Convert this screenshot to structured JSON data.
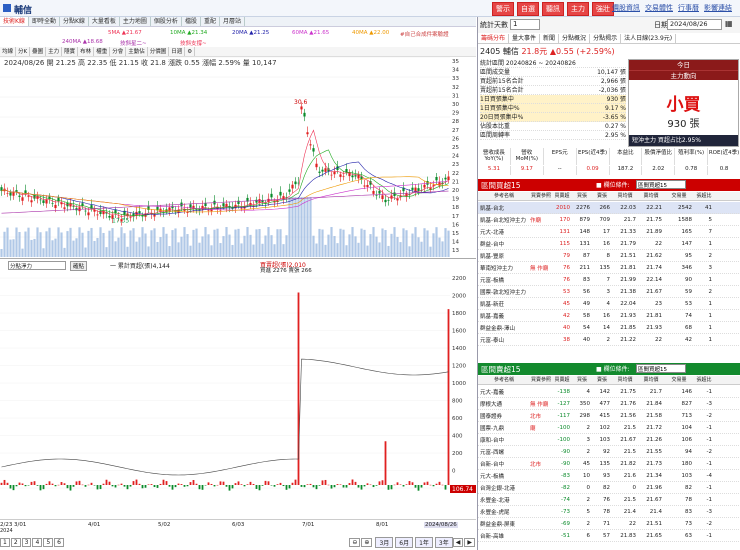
{
  "stock": {
    "name": "輔信"
  },
  "top_buttons": [
    "警示",
    "自選",
    "聽訊",
    "主力",
    "強壯"
  ],
  "top_links": [
    "價股資訊",
    "交易體性",
    "行事曆",
    "影響連結"
  ],
  "left_tabs": [
    "技術K線",
    "即時全動",
    "分點K線",
    "大量看板",
    "主力地圖",
    "個股分析",
    "檔股",
    "重配",
    "月層站"
  ],
  "ma_legend": {
    "ma5": "5MA ▲21.67",
    "ma10": "10MA ▲21.34",
    "ma20": "20MA ▲21.25",
    "ma60": "60MA ▲21.65",
    "ma40": "40MA ▲22.00",
    "ma240": "240MA ▲18.68",
    "slope1": "技斜星二~",
    "slope2": "技斜支撐~",
    "verify": "#自己合成件案驗證"
  },
  "toolbar": [
    "均線",
    "分K",
    "疊圖",
    "主力",
    "隱實",
    "布林",
    "權重",
    "分會",
    "主動佔",
    "分價圖",
    "日週"
  ],
  "price_info": "2024/08/26 開 21.25 高 22.35 低 21.15 收 21.8 漲跌 0.55 漲幅 2.59% 量 10,147",
  "price_scale": [
    "35",
    "34",
    "33",
    "32",
    "31",
    "30",
    "29",
    "28",
    "27",
    "26",
    "25",
    "24",
    "23",
    "22",
    "21",
    "20",
    "19",
    "18",
    "17",
    "16",
    "15",
    "14",
    "13"
  ],
  "price_annot": {
    "peak": "30.6",
    "low": "17.35"
  },
  "sub_header": {
    "select": "分點淨力",
    "button": "確點",
    "legend1": "一 累計買超(張)4,144",
    "legend2": "買賣超(張)2,010",
    "legend3": "買進 2276  賣張 266"
  },
  "vol_scale": [
    "2200",
    "2000",
    "1800",
    "1600",
    "1400",
    "1200",
    "1000",
    "800",
    "600",
    "400",
    "200",
    "0",
    "-200"
  ],
  "vol_last": "106.74",
  "dates": [
    "2/23",
    "3/01",
    "4/01",
    "5/02",
    "6/03",
    "7/01",
    "8/01",
    "2024/08/26"
  ],
  "date_year": "2024",
  "pages": [
    "1",
    "2",
    "3",
    "4",
    "5",
    "6"
  ],
  "ranges": [
    "3月",
    "6月",
    "1年",
    "3年"
  ],
  "right": {
    "days_label": "統計天數",
    "days_value": "1",
    "date_label": "日期",
    "date_value": "2024/08/26",
    "tabs": [
      "籌碼分布",
      "量大事件",
      "新聞",
      "分點概況",
      "分點揭示",
      "法人日線(23.9元)"
    ],
    "code": "2405",
    "name": "輔信",
    "price": "21.8元",
    "change": "▲0.55 (+2.59%)",
    "summary": [
      [
        "統計區間  20240826 ~ 20240826",
        ""
      ],
      [
        "區間成交量",
        "10,147 張"
      ],
      [
        "買超前15名合計",
        "2,966 張"
      ],
      [
        "賣超前15名合計",
        "-2,036 張"
      ],
      [
        "1日買張集中",
        "930 張"
      ],
      [
        "1日買張集中%",
        "9.17 %"
      ],
      [
        "20日買張集中%",
        "-3.65 %"
      ],
      [
        "佔股本比重",
        "0.27 %"
      ],
      [
        "區間周轉率",
        "2.95 %"
      ]
    ],
    "today_label": "今日",
    "force_label": "主力動向",
    "signal": "小買",
    "signal_vol": "930 張",
    "bar_text": "短沖主力  買超占比2.95%",
    "fund_headers": [
      "營收成長YoY(%)",
      "營收MoM(%)",
      "EPS元",
      "EPS(近4季)",
      "本益比",
      "股價淨值比",
      "殖利率(%)",
      "ROE(近4季)"
    ],
    "fund_values": [
      "5.31",
      "9.17",
      "--",
      "0.09",
      "187.2",
      "2.02",
      "0.78",
      "0.8"
    ],
    "buy_title": "區間買超15",
    "sell_title": "區間賣超15",
    "field_label": "■ 欄位條件:",
    "field_value": "區間買超15",
    "table_headers": [
      "參考名稱",
      "買賣參照",
      "買賣超",
      "買張",
      "賣張",
      "買均價",
      "賣均價",
      "交易量",
      "張超比"
    ],
    "buy_rows": [
      [
        "凱基-台北",
        "",
        "2010",
        "2276",
        "266",
        "22.03",
        "22.21",
        "2542",
        "41"
      ],
      [
        "凱基-台北短沖主力",
        "作廟",
        "170",
        "879",
        "709",
        "21.7",
        "21.75",
        "1588",
        "5"
      ],
      [
        "元大-北港",
        "",
        "131",
        "148",
        "17",
        "21.33",
        "21.89",
        "165",
        "7"
      ],
      [
        "群益-台中",
        "",
        "115",
        "131",
        "16",
        "21.79",
        "22",
        "147",
        "1"
      ],
      [
        "凱基-豐原",
        "",
        "79",
        "87",
        "8",
        "21.51",
        "21.62",
        "95",
        "2"
      ],
      [
        "華南短沖主力",
        "無 作廟",
        "76",
        "211",
        "135",
        "21.81",
        "21.74",
        "346",
        "3"
      ],
      [
        "元富-板橋",
        "",
        "76",
        "83",
        "7",
        "21.99",
        "22.14",
        "90",
        "1"
      ],
      [
        "國票-敦北短沖主力",
        "",
        "53",
        "56",
        "3",
        "21.38",
        "21.67",
        "59",
        "2"
      ],
      [
        "凱基-新莊",
        "",
        "45",
        "49",
        "4",
        "22.04",
        "23",
        "53",
        "1"
      ],
      [
        "凱基-嘉義",
        "",
        "42",
        "58",
        "16",
        "21.93",
        "21.81",
        "74",
        "1"
      ],
      [
        "群益金鼎-澤山",
        "",
        "40",
        "54",
        "14",
        "21.85",
        "21.93",
        "68",
        "1"
      ],
      [
        "元富-泰山",
        "",
        "38",
        "40",
        "2",
        "21.22",
        "22",
        "42",
        "1"
      ]
    ],
    "sell_rows": [
      [
        "元大-嘉義",
        "",
        "-138",
        "4",
        "142",
        "21.75",
        "21.7",
        "146",
        "-1"
      ],
      [
        "摩根大通",
        "無 作廟",
        "-127",
        "350",
        "477",
        "21.76",
        "21.84",
        "827",
        "-3"
      ],
      [
        "國泰證券",
        "北市",
        "-117",
        "298",
        "415",
        "21.56",
        "21.58",
        "713",
        "-2"
      ],
      [
        "國票-九鼎",
        "廟",
        "-100",
        "2",
        "102",
        "21.5",
        "21.72",
        "104",
        "-1"
      ],
      [
        "康和-台中",
        "",
        "-100",
        "3",
        "103",
        "21.67",
        "21.26",
        "106",
        "-1"
      ],
      [
        "元富-西螺",
        "",
        "-90",
        "2",
        "92",
        "21.5",
        "21.55",
        "94",
        "-2"
      ],
      [
        "台新-台中",
        "北市",
        "-90",
        "45",
        "135",
        "21.82",
        "21.73",
        "180",
        "-1"
      ],
      [
        "元大-板橋",
        "",
        "-83",
        "10",
        "93",
        "21.6",
        "21.34",
        "103",
        "-4"
      ],
      [
        "台灣企銀-北港",
        "",
        "-82",
        "0",
        "82",
        "0",
        "21.96",
        "82",
        "-1"
      ],
      [
        "永豐金-北港",
        "",
        "-74",
        "2",
        "76",
        "21.5",
        "21.67",
        "78",
        "-1"
      ],
      [
        "永豐金-虎尾",
        "",
        "-73",
        "5",
        "78",
        "21.4",
        "21.4",
        "83",
        "-3"
      ],
      [
        "群益金鼎-屏東",
        "",
        "-69",
        "2",
        "71",
        "22",
        "21.51",
        "73",
        "-2"
      ],
      [
        "台新-高雄",
        "",
        "-51",
        "6",
        "57",
        "21.83",
        "21.65",
        "63",
        "-1"
      ]
    ]
  },
  "colors": {
    "up": "#e02020",
    "down": "#0a8a2a",
    "accent": "#1a3a7a",
    "buy_header": "#c00",
    "sell_header": "#138a2e"
  }
}
